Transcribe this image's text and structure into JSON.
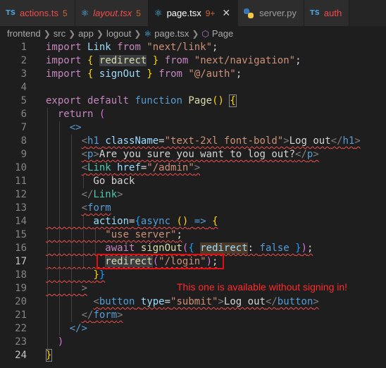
{
  "tabs": [
    {
      "icon": "TS",
      "label": "actions.ts",
      "badge": "5",
      "badge_color": "#cc6633"
    },
    {
      "icon": "TS",
      "label": "layout.tsx",
      "badge": "5",
      "italic": true
    },
    {
      "icon": "TSX",
      "label": "page.tsx",
      "badge": "9+",
      "active": true,
      "close": "✕"
    },
    {
      "icon": "PY",
      "label": "server.py"
    },
    {
      "icon": "TS",
      "label": "auth"
    }
  ],
  "breadcrumb": [
    "frontend",
    "src",
    "app",
    "logout",
    "page.tsx",
    "Page"
  ],
  "line_numbers": [
    "1",
    "2",
    "3",
    "4",
    "5",
    "6",
    "7",
    "8",
    "9",
    "10",
    "11",
    "12",
    "13",
    "14",
    "15",
    "16",
    "17",
    "18",
    "19",
    "20",
    "21",
    "22",
    "23",
    "24"
  ],
  "code_lines": [
    "import Link from \"next/link\";",
    "import { redirect } from \"next/navigation\";",
    "import { signOut } from \"@/auth\";",
    "",
    "export default function Page() {",
    "  return (",
    "    <>",
    "      <h1 className=\"text-2xl font-bold\">Log out</h1>",
    "      <p>Are you sure you want to log out?</p>",
    "      <Link href=\"/admin\">",
    "        Go back",
    "      </Link>",
    "      <form",
    "        action={async () => {",
    "          \"use server\";",
    "          await signOut({ redirect: false });",
    "          redirect(\"/login\");",
    "        }}",
    "      >",
    "        <button type=\"submit\">Log out</button>",
    "      </form>",
    "    </>",
    "  )",
    "}"
  ],
  "annotation": "This one is available without signing in!",
  "colors": {
    "keyword": "#c586c0",
    "storage": "#569cd6",
    "string": "#ce9178",
    "function": "#dcdcaa",
    "variable": "#9cdcfe",
    "component": "#4ec9b0",
    "annotation": "#ff2a2a",
    "error_squiggle": "#f14c4c"
  }
}
